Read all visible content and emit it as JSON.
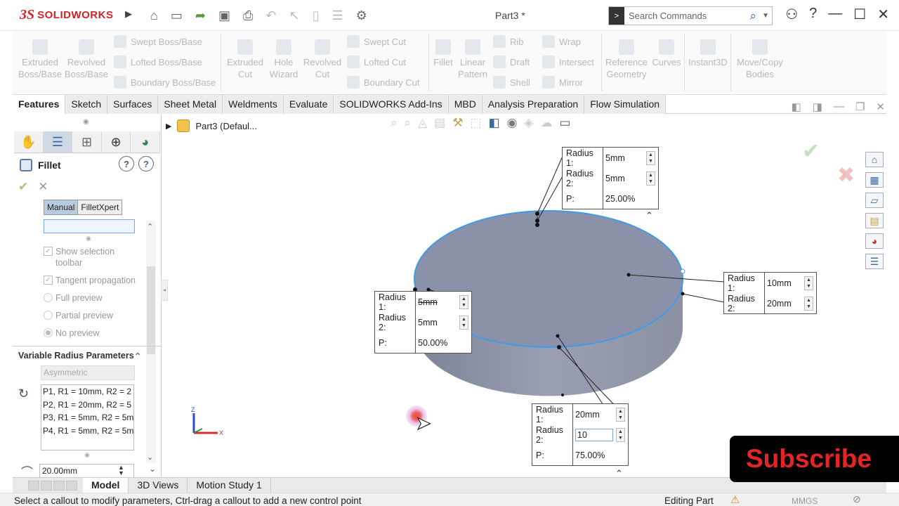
{
  "app": {
    "brand_ds": "3S",
    "brand_name": "SOLIDWORKS",
    "doc_title": "Part3 *",
    "search_placeholder": "Search Commands"
  },
  "ribbon": {
    "extruded_boss": "Extruded\nBoss/Base",
    "revolved_boss": "Revolved\nBoss/Base",
    "swept_boss": "Swept Boss/Base",
    "lofted_boss": "Lofted Boss/Base",
    "boundary_boss": "Boundary Boss/Base",
    "extruded_cut": "Extruded\nCut",
    "hole_wizard": "Hole\nWizard",
    "revolved_cut": "Revolved\nCut",
    "swept_cut": "Swept Cut",
    "lofted_cut": "Lofted Cut",
    "boundary_cut": "Boundary Cut",
    "fillet": "Fillet",
    "linear_pattern": "Linear\nPattern",
    "rib": "Rib",
    "draft": "Draft",
    "shell": "Shell",
    "wrap": "Wrap",
    "intersect": "Intersect",
    "mirror": "Mirror",
    "ref_geom": "Reference\nGeometry",
    "curves": "Curves",
    "instant3d": "Instant3D",
    "move_copy": "Move/Copy\nBodies"
  },
  "tabs": [
    "Features",
    "Sketch",
    "Surfaces",
    "Sheet Metal",
    "Weldments",
    "Evaluate",
    "SOLIDWORKS Add-Ins",
    "MBD",
    "Analysis Preparation",
    "Flow Simulation"
  ],
  "panel": {
    "title": "Fillet",
    "mode_manual": "Manual",
    "mode_xpert": "FilletXpert",
    "opt_show_selection": "Show selection toolbar",
    "opt_tangent": "Tangent propagation",
    "opt_full": "Full preview",
    "opt_partial": "Partial preview",
    "opt_no": "No preview",
    "vrp_title": "Variable Radius Parameters",
    "asym": "Asymmetric",
    "points": [
      "P1, R1 = 10mm, R2 = 2",
      "P2, R1 = 20mm, R2 = 5",
      "P3, R1 = 5mm, R2 = 5m",
      "P4, R1 = 5mm, R2 = 5m"
    ],
    "value": "20.00mm"
  },
  "tree": {
    "item": "Part3  (Defaul..."
  },
  "callouts": {
    "top": {
      "r1_label": "Radius 1:",
      "r1": "5mm",
      "r2_label": "Radius 2:",
      "r2": "5mm",
      "p_label": "P:",
      "p": "25.00%"
    },
    "right": {
      "r1_label": "Radius 1:",
      "r1": "10mm",
      "r2_label": "Radius 2:",
      "r2": "20mm"
    },
    "left": {
      "r1_label": "Radius 1:",
      "r1": "5mm",
      "r2_label": "Radius 2:",
      "r2": "5mm",
      "p_label": "P:",
      "p": "50.00%"
    },
    "bottom": {
      "r1_label": "Radius 1:",
      "r1": "20mm",
      "r2_label": "Radius 2:",
      "r2": "10",
      "p_label": "P:",
      "p": "75.00%"
    }
  },
  "bottom_tabs": [
    "Model",
    "3D Views",
    "Motion Study 1"
  ],
  "status": {
    "message": "Select a callout to modify parameters, Ctrl-drag a callout to add a new control point",
    "editing": "Editing Part",
    "units": "MMGS"
  },
  "overlay": {
    "subscribe": "Subscribe"
  },
  "colors": {
    "brand": "#d8202a",
    "selection_blue": "#3d9be9",
    "body_gray": "#8a91a8",
    "subscribe_red": "#e52525"
  }
}
